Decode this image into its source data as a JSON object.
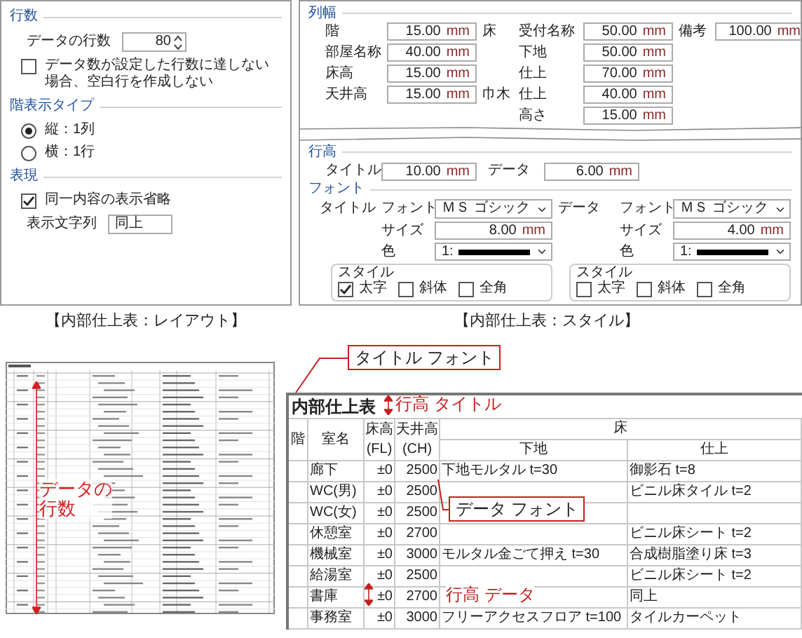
{
  "layout_dialog": {
    "rows_group": {
      "title": "行数",
      "data_rows_label": "データの行数",
      "data_rows_value": "80",
      "no_blank_rows": {
        "label": "データ数が設定した行数に達しない場合、空白行を作成しない",
        "checked": false
      }
    },
    "floor_type_group": {
      "title": "階表示タイプ",
      "options": [
        {
          "label": "縦：1列",
          "selected": true
        },
        {
          "label": "横：1行",
          "selected": false
        }
      ]
    },
    "display_group": {
      "title": "表現",
      "omit_same": {
        "label": "同一内容の表示省略",
        "checked": true
      },
      "string_label": "表示文字列",
      "string_value": "同上"
    }
  },
  "style_dialog": {
    "column_width": {
      "title": "列幅",
      "left": [
        {
          "label": "階",
          "value": "15.00",
          "unit": "mm"
        },
        {
          "label": "部屋名称",
          "value": "40.00",
          "unit": "mm"
        },
        {
          "label": "床高",
          "value": "15.00",
          "unit": "mm"
        },
        {
          "label": "天井高",
          "value": "15.00",
          "unit": "mm"
        }
      ],
      "middle": [
        {
          "group": "床",
          "label": "受付名称",
          "value": "50.00",
          "unit": "mm"
        },
        {
          "label": "下地",
          "value": "50.00",
          "unit": "mm"
        },
        {
          "label": "仕上",
          "value": "70.00",
          "unit": "mm"
        },
        {
          "group": "巾木",
          "label": "仕上",
          "value": "40.00",
          "unit": "mm"
        },
        {
          "label": "高さ",
          "value": "15.00",
          "unit": "mm"
        }
      ],
      "right": [
        {
          "label": "備考",
          "value": "100.00",
          "unit": "mm"
        }
      ]
    },
    "row_height": {
      "title": "行高",
      "items": [
        {
          "label": "タイトル",
          "value": "10.00",
          "unit": "mm"
        },
        {
          "label": "データ",
          "value": "6.00",
          "unit": "mm"
        }
      ]
    },
    "font": {
      "title": "フォント",
      "blocks": [
        {
          "name": "タイトル",
          "font_label": "フォント",
          "font": "ＭＳ ゴシック",
          "size_label": "サイズ",
          "size": "8.00",
          "unit": "mm",
          "color_label": "色",
          "color_value": "1:",
          "style_title": "スタイル",
          "styles": [
            {
              "label": "太字",
              "checked": true
            },
            {
              "label": "斜体",
              "checked": false
            },
            {
              "label": "全角",
              "checked": false
            }
          ]
        },
        {
          "name": "データ",
          "font_label": "フォント",
          "font": "ＭＳ ゴシック",
          "size_label": "サイズ",
          "size": "4.00",
          "unit": "mm",
          "color_label": "色",
          "color_value": "1:",
          "style_title": "スタイル",
          "styles": [
            {
              "label": "太字",
              "checked": false
            },
            {
              "label": "斜体",
              "checked": false
            },
            {
              "label": "全角",
              "checked": false
            }
          ]
        }
      ]
    }
  },
  "captions": [
    "【内部仕上表：レイアウト】",
    "【内部仕上表：スタイル】"
  ],
  "preview": {
    "annotation": "データの行数"
  },
  "sample": {
    "title": "内部仕上表",
    "columns": [
      {
        "label": "階"
      },
      {
        "label": "室名"
      },
      {
        "label": "床高",
        "sub": "(FL)"
      },
      {
        "label": "天井高",
        "sub": "(CH)"
      }
    ],
    "group_header": {
      "label": "床",
      "subcolumns": [
        "下地",
        "仕上"
      ]
    },
    "rows": [
      {
        "room": "廊下",
        "fl": "±0",
        "ch": "2500",
        "base": "下地モルタル t=30",
        "finish": "御影石 t=8"
      },
      {
        "room": "WC(男)",
        "fl": "±0",
        "ch": "2500",
        "base": "",
        "finish": "ビニル床タイル t=2"
      },
      {
        "room": "WC(女)",
        "fl": "±0",
        "ch": "2500",
        "base": "",
        "finish": ""
      },
      {
        "room": "休憩室",
        "fl": "±0",
        "ch": "2700",
        "base": "",
        "finish": "ビニル床シート t=2"
      },
      {
        "room": "機械室",
        "fl": "±0",
        "ch": "3000",
        "base": "モルタル金ごて押え t=30",
        "finish": "合成樹脂塗り床 t=3"
      },
      {
        "room": "給湯室",
        "fl": "±0",
        "ch": "2500",
        "base": "",
        "finish": "ビニル床シート t=2"
      },
      {
        "room": "書庫",
        "fl": "±0",
        "ch": "2700",
        "base": "",
        "finish": "同上"
      },
      {
        "room": "事務室",
        "fl": "±0",
        "ch": "3000",
        "base": "フリーアクセスフロア t=100",
        "finish": "タイルカーペット"
      }
    ],
    "annotations": {
      "title_font": "タイトル フォント",
      "title_height": "行高 タイトル",
      "data_font": "データ フォント",
      "data_height": "行高 データ"
    }
  }
}
